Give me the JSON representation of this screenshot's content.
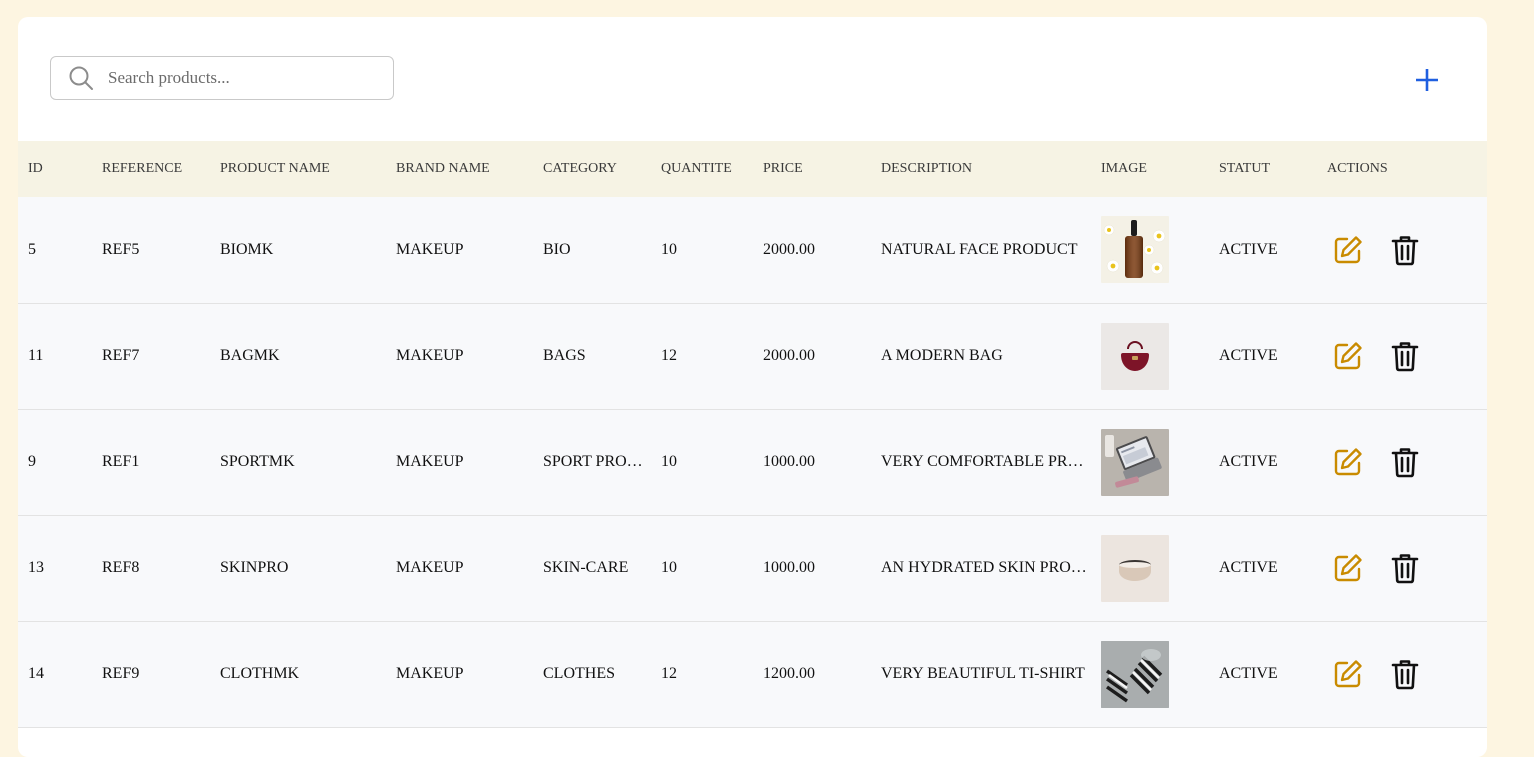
{
  "search": {
    "placeholder": "Search products...",
    "value": ""
  },
  "toolbar": {
    "add_icon": "plus-icon"
  },
  "table": {
    "columns": [
      "ID",
      "REFERENCE",
      "PRODUCT NAME",
      "BRAND NAME",
      "CATEGORY",
      "QUANTITE",
      "PRICE",
      "DESCRIPTION",
      "IMAGE",
      "STATUT",
      "ACTIONS"
    ],
    "rows": [
      {
        "id": "5",
        "ref": "REF5",
        "name": "BIOMK",
        "brand": "MAKEUP",
        "category": "BIO",
        "qty": "10",
        "price": "2000.00",
        "description": "NATURAL FACE PRODUCT",
        "image": "serum-bottle-with-daisies",
        "status": "ACTIVE"
      },
      {
        "id": "11",
        "ref": "REF7",
        "name": "BAGMK",
        "brand": "MAKEUP",
        "category": "BAGS",
        "qty": "12",
        "price": "2000.00",
        "description": "A MODERN BAG",
        "image": "burgundy-handbag",
        "status": "ACTIVE"
      },
      {
        "id": "9",
        "ref": "REF1",
        "name": "SPORTMK",
        "brand": "MAKEUP",
        "category": "SPORT PRODUCTS",
        "qty": "10",
        "price": "1000.00",
        "description": "VERY COMFORTABLE PRODUCT",
        "image": "laptop-on-desk",
        "status": "ACTIVE"
      },
      {
        "id": "13",
        "ref": "REF8",
        "name": "SKINPRO",
        "brand": "MAKEUP",
        "category": "SKIN-CARE",
        "qty": "10",
        "price": "1000.00",
        "description": "AN HYDRATED SKIN PRODUCT",
        "image": "cream-jar",
        "status": "ACTIVE"
      },
      {
        "id": "14",
        "ref": "REF9",
        "name": "CLOTHMK",
        "brand": "MAKEUP",
        "category": "CLOTHES",
        "qty": "12",
        "price": "1200.00",
        "description": "VERY BEAUTIFUL TI-SHIRT",
        "image": "striped-clothing",
        "status": "ACTIVE"
      }
    ]
  },
  "icons": {
    "edit": "edit-icon",
    "delete": "trash-icon",
    "search": "search-icon"
  },
  "colors": {
    "edit": "#c98b00",
    "add": "#1f5fe0",
    "header_bg": "#f6f3e4",
    "page_bg": "#fdf5e1"
  }
}
